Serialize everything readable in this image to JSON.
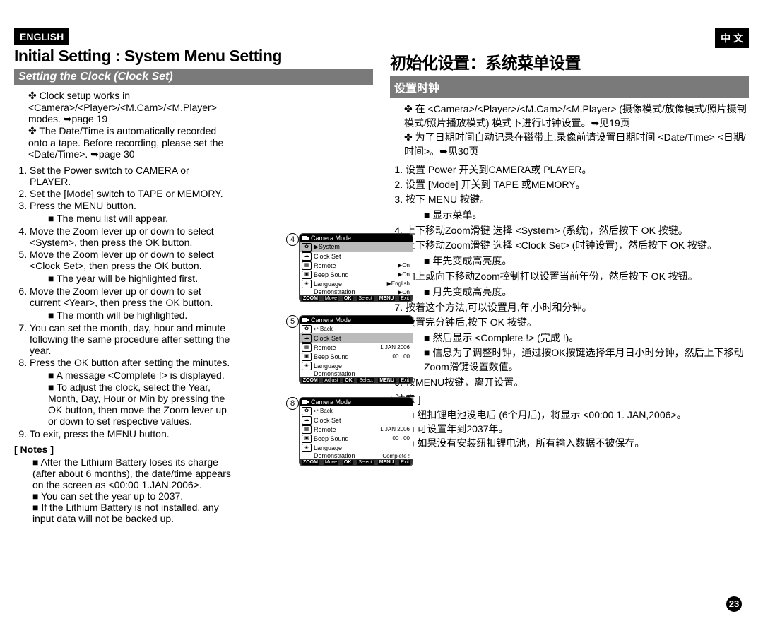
{
  "header": {
    "lang_en": "ENGLISH",
    "lang_cn": "中 文",
    "title_en": "Initial Setting : System Menu Setting",
    "title_cn": "初始化设置：系统菜单设置",
    "sub_en": "Setting the Clock (Clock Set)",
    "sub_cn": "设置时钟"
  },
  "en": {
    "bul1": "Clock setup works in <Camera>/<Player>/<M.Cam>/<M.Player> modes. ➥page 19",
    "bul2": "The Date/Time is automatically recorded onto a tape. Before recording, please set the <Date/Time>. ➥page 30",
    "s1": "Set the Power switch to CAMERA or PLAYER.",
    "s2": "Set the [Mode] switch to TAPE or MEMORY.",
    "s3": "Press the MENU button.",
    "s3a": "The menu list will appear.",
    "s4": "Move the Zoom lever up or down to select <System>, then press the OK button.",
    "s5": "Move the Zoom lever up or down to select <Clock Set>, then press the OK button.",
    "s5a": "The year will be highlighted first.",
    "s6": "Move the Zoom lever up or down to set current <Year>, then press the OK button.",
    "s6a": "The month will be highlighted.",
    "s7": "You can set the month, day, hour and minute following the same procedure after setting the year.",
    "s8": "Press the OK button after setting the minutes.",
    "s8a": "A message <Complete !> is displayed.",
    "s8b": "To adjust the clock, select the Year, Month, Day, Hour or Min by pressing the OK button, then move the Zoom lever up or down to set respective values.",
    "s9": "To exit, press the MENU button.",
    "notes_title": "[ Notes ]",
    "n1": "After the Lithium Battery loses its charge (after about 6 months), the date/time appears on the screen as <00:00 1.JAN.2006>.",
    "n2": "You can set the year up to 2037.",
    "n3": "If the Lithium Battery is not installed, any input data will not be backed up."
  },
  "cn": {
    "bul1": "在 <Camera>/<Player>/<M.Cam>/<M.Player> (摄像模式/放像模式/照片摄制模式/照片播放模式) 模式下进行时钟设置。➥见19页",
    "bul2": "为了日期时间自动记录在磁带上,录像前请设置日期时间 <Date/Time> <日期/时间>。➥见30页",
    "s1": "设置 Power 开关到CAMERA或 PLAYER。",
    "s2": "设置 [Mode] 开关到 TAPE 或MEMORY。",
    "s3": "按下 MENU 按键。",
    "s3a": "显示菜单。",
    "s4": "上下移动Zoom滑键 选择 <System> (系统)，然后按下 OK 按键。",
    "s5": "上下移动Zoom滑键 选择 <Clock Set> (时钟设置)，然后按下 OK 按键。",
    "s5a": "年先变成高亮度。",
    "s6": "向上或向下移动Zoom控制杆以设置当前年份，然后按下 OK 按钮。",
    "s6a": "月先变成高亮度。",
    "s7": "按着这个方法,可以设置月,年,小时和分钟。",
    "s8": "设置完分钟后,按下 OK 按键。",
    "s8a": "然后显示 <Complete !> (完成 !)。",
    "s8b": "信息为了调整时钟，通过按OK按键选择年月日小时分钟，然后上下移动 Zoom滑键设置数值。",
    "s9": "按MENU按键，离开设置。",
    "notes_title": "[ 注意 ]",
    "n1": "纽扣锂电池没电后 (6个月后)，将显示 <00:00 1. JAN,2006>。",
    "n2": "可设置年到2037年。",
    "n3": "如果没有安装纽扣锂电池，所有输入数据不被保存。"
  },
  "screens": {
    "mode_title": "Camera Mode",
    "system": "System",
    "back": "Back",
    "clock_set": "Clock Set",
    "remote": "Remote",
    "beep": "Beep Sound",
    "language": "Language",
    "demo": "Demonstration",
    "on": "▶On",
    "eng": "▶English",
    "date": "1 JAN 2006",
    "time": "00 : 00",
    "complete": "Complete !",
    "zoom": "ZOOM",
    "move": "Move",
    "adjust": "Adjust",
    "ok": "OK",
    "select": "Select",
    "menu": "MENU",
    "exit": "Exit",
    "num4": "4",
    "num5": "5",
    "num8": "8"
  },
  "page_number": "23"
}
